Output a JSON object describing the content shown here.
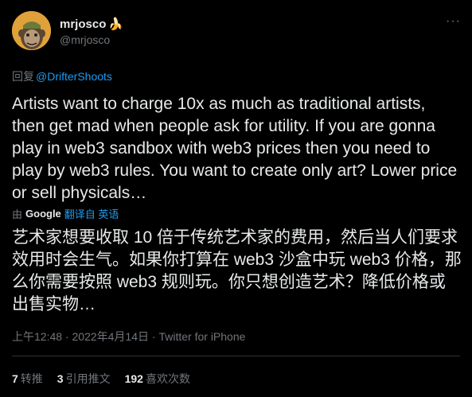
{
  "author": {
    "display_name": "mrjosco",
    "emoji": "🍌",
    "handle": "@mrjosco"
  },
  "more_label": "···",
  "reply": {
    "prefix": "回复",
    "to": "@DrifterShoots"
  },
  "tweet": {
    "text": "Artists want to charge 10x as much as traditional artists, then get mad when people ask for utility. If you are gonna play in web3 sandbox with web3 prices then you need to play by web3 rules. You want to create only art? Lower price or sell physicals…"
  },
  "translation": {
    "from_label": "由",
    "provider": "Google",
    "link_label": "翻译自 英语",
    "text": "艺术家想要收取 10 倍于传统艺术家的费用，然后当人们要求效用时会生气。如果你打算在 web3 沙盒中玩 web3 价格，那么你需要按照 web3 规则玩。你只想创造艺术？降低价格或出售实物…"
  },
  "meta": {
    "time": "上午12:48",
    "date": "2022年4月14日",
    "sep": "·",
    "source": "Twitter for iPhone"
  },
  "stats": {
    "retweets": "7",
    "retweets_label": "转推",
    "quotes": "3",
    "quotes_label": "引用推文",
    "likes": "192",
    "likes_label": "喜欢次数"
  }
}
